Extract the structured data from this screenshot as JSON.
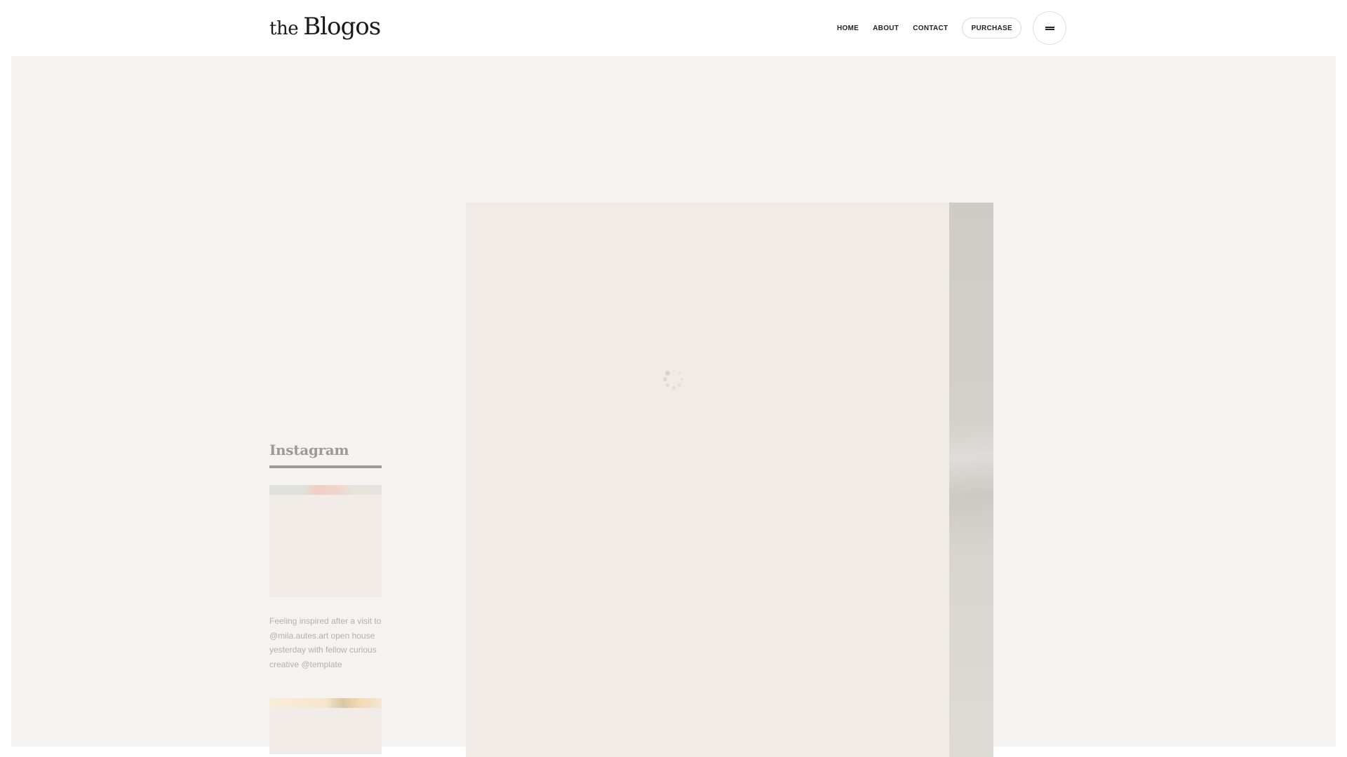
{
  "header": {
    "logo_prefix": "the",
    "logo_name": "Blogos",
    "nav": {
      "home": "HOME",
      "about": "ABOUT",
      "contact": "CONTACT",
      "purchase": "PURCHASE"
    },
    "menu_icon": "hamburger-menu-icon"
  },
  "sidebar": {
    "widget_title": "Instagram",
    "posts": [
      {
        "caption": "Feeling inspired after a visit to @mila.autes.art open house yesterday with fellow curious creative @template"
      }
    ]
  },
  "lightbox": {
    "loading_icon": "loading-spinner-icon"
  },
  "colors": {
    "backdrop": "#f4f3f1",
    "image_placeholder": "#f0ebe7",
    "text_muted": "#9a9a9a",
    "nav_text": "#222222"
  }
}
